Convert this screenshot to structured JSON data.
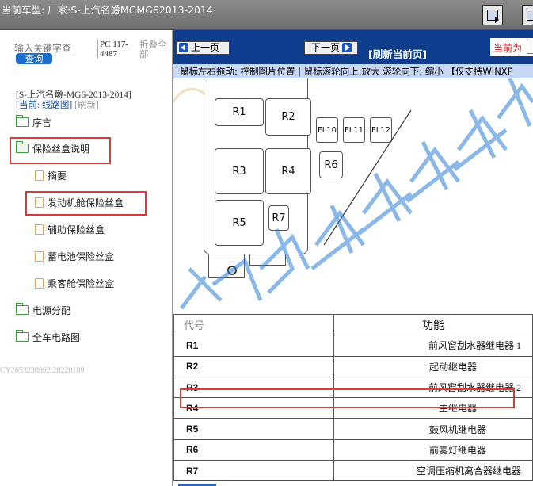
{
  "topbar": {
    "title": "当前车型:  厂家:S-上汽名爵MGMG62013-2014"
  },
  "sidebar": {
    "search_placeholder": "输入关键字查",
    "search_button": "查询",
    "pc_code": "PC 117-4487",
    "fold_all": "折叠全部",
    "car_model": "[S-上汽名爵-MG6-2013-2014]",
    "current_prefix": "[当前: 线路图]",
    "refresh": "[刷新]",
    "watermark_id": "CY2653230862.20220109",
    "tree": [
      {
        "label": "序言",
        "type": "folder"
      },
      {
        "label": "保险丝盒说明",
        "type": "folder-open"
      },
      {
        "label": "摘要",
        "type": "doc"
      },
      {
        "label": "发动机舱保险丝盒",
        "type": "doc"
      },
      {
        "label": "辅助保险丝盒",
        "type": "doc"
      },
      {
        "label": "蓄电池保险丝盒",
        "type": "doc"
      },
      {
        "label": "乘客舱保险丝盒",
        "type": "doc"
      },
      {
        "label": "电源分配",
        "type": "folder"
      },
      {
        "label": "全车电路图",
        "type": "folder"
      }
    ]
  },
  "toolbar": {
    "prev": "上一页",
    "next": "下一页",
    "refresh": "[刷新当前页]",
    "current": "当前为",
    "hint": "鼠标左右拖动: 控制图片位置 | 鼠标滚轮向上:放大  滚轮向下: 缩小 【仅支持WINXP"
  },
  "diagram": {
    "relays": [
      "R1",
      "R2",
      "R3",
      "R4",
      "R5",
      "R6",
      "R7"
    ],
    "fuses": [
      "FL10",
      "FL11",
      "FL12"
    ],
    "colors": {
      "watermark": "#2c7fd6",
      "highlight": "#d63c3c",
      "nav": "#0d3d8c"
    }
  },
  "table": {
    "header": {
      "code": "代号",
      "function": "功能"
    },
    "rows": [
      {
        "code": "R1",
        "function": "前风窗刮水器继电器 1"
      },
      {
        "code": "R2",
        "function": "起动继电器"
      },
      {
        "code": "R3",
        "function": "前风窗刮水器继电器 2"
      },
      {
        "code": "R4",
        "function": "主继电器"
      },
      {
        "code": "R5",
        "function": "鼓风机继电器"
      },
      {
        "code": "R6",
        "function": "前雾灯继电器"
      },
      {
        "code": "R7",
        "function": "空调压缩机离合器继电器"
      }
    ]
  }
}
